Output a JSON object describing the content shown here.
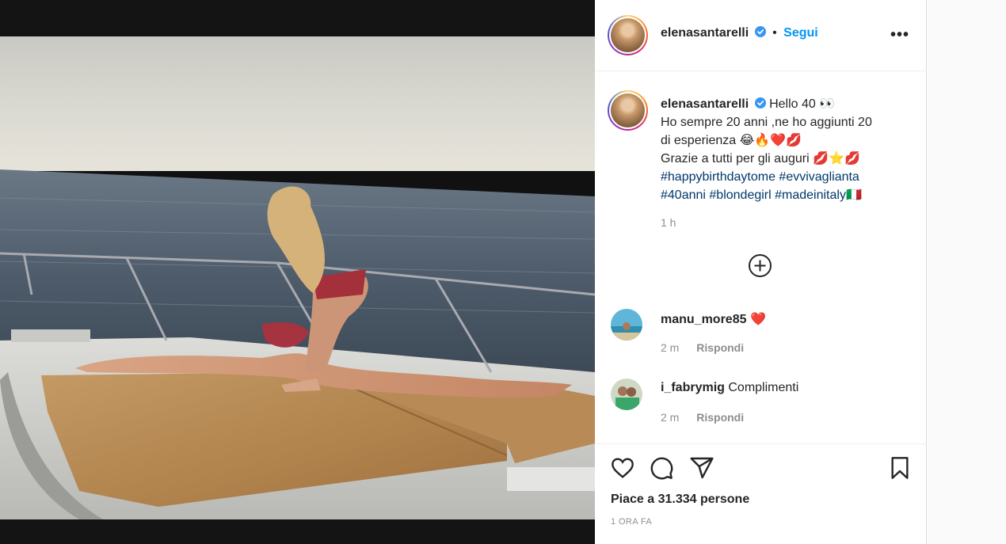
{
  "post": {
    "author": "elenasantarelli",
    "follow_label": "Segui",
    "separator": "•",
    "more_label": "•••",
    "caption": {
      "line1": "Hello 40 👀",
      "line2": "Ho sempre 20 anni ,ne ho aggiunti 20",
      "line3": "di esperienza 😂🔥❤️💋",
      "line4": "Grazie a tutti per gli auguri 💋⭐💋",
      "hashtags1": "#happybirthdaytome #evvivaglianta",
      "hashtags2": "#40anni #blondegirl #madeinitaly🇮🇹"
    },
    "caption_time": "1 h",
    "likes_text": "Piace a 31.334 persone",
    "post_date": "1 ORA FA"
  },
  "comments": [
    {
      "user": "manu_more85",
      "text": "❤️",
      "time": "2 m",
      "reply_label": "Rispondi"
    },
    {
      "user": "i_fabrymig",
      "text": "Complimenti",
      "time": "2 m",
      "reply_label": "Rispondi"
    }
  ],
  "icons": {
    "verified": "verified-badge-icon",
    "more": "more-options-icon",
    "load_more": "plus-circle-icon",
    "like": "heart-icon",
    "comment": "comment-icon",
    "share": "share-icon",
    "save": "bookmark-icon"
  },
  "colors": {
    "accent": "#0095f6",
    "hashtag": "#00376b",
    "muted": "#8e8e8e",
    "verified": "#3897f0"
  }
}
